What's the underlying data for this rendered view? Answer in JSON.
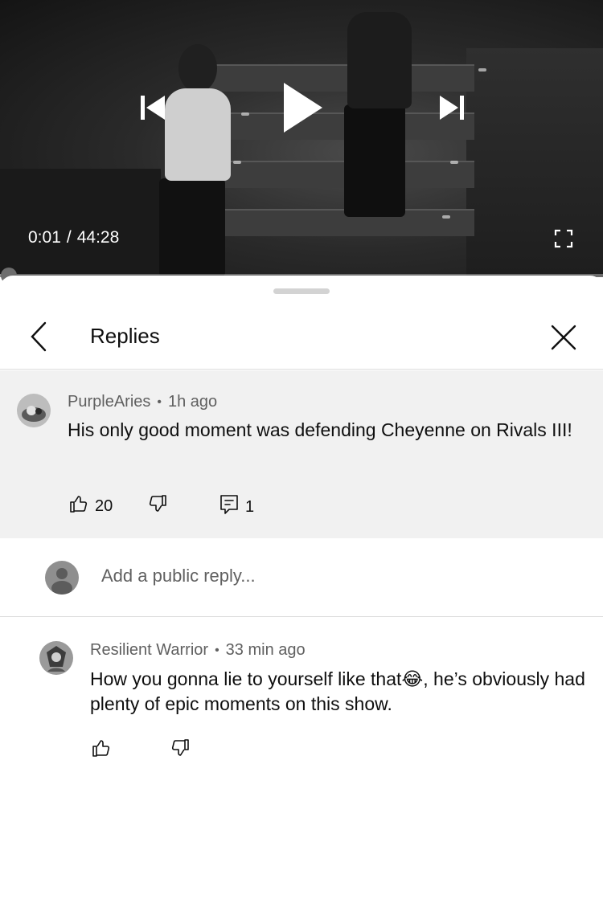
{
  "player": {
    "current_time": "0:01",
    "separator": "/",
    "duration": "44:28",
    "progress_fraction": 0.0004
  },
  "sheet": {
    "title": "Replies"
  },
  "parent_comment": {
    "author": "PurpleAries",
    "dot": "•",
    "time": "1h ago",
    "text": "His only good moment was defending Cheyenne on Rivals III!",
    "likes": "20",
    "replies": "1"
  },
  "reply_box": {
    "placeholder": "Add a public reply..."
  },
  "replies": [
    {
      "author": "Resilient Warrior",
      "dot": "•",
      "time": "33 min ago",
      "text_before": "How you gonna lie to yourself like that",
      "emoji": "😂",
      "text_after": ", he’s obviously had plenty of epic moments on this show."
    }
  ],
  "icons": {
    "previous": "skip-previous-icon",
    "play": "play-icon",
    "next": "skip-next-icon",
    "fullscreen": "fullscreen-icon",
    "back": "back-arrow-icon",
    "close": "close-icon",
    "like": "thumbs-up-icon",
    "dislike": "thumbs-down-icon",
    "reply": "comment-icon"
  }
}
